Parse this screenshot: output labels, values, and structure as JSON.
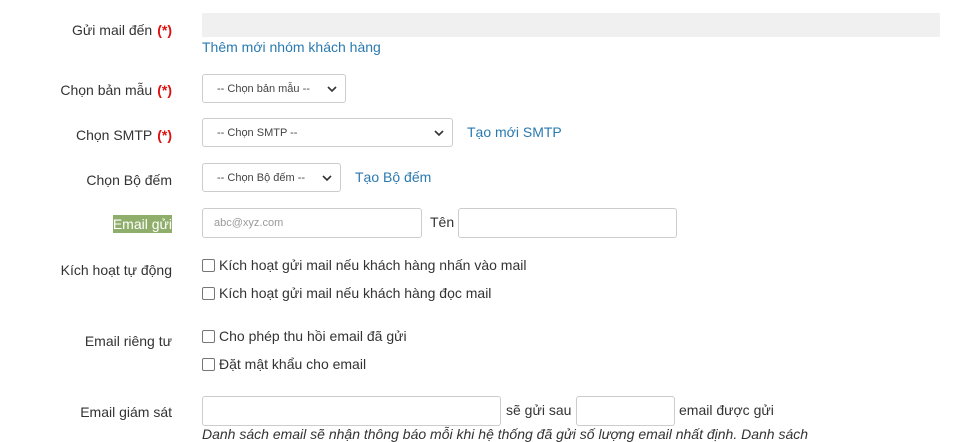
{
  "form": {
    "recipients": {
      "label": "Gửi mail đến",
      "required": "(*)",
      "value": "",
      "add_group_link": "Thêm mới nhóm khách hàng"
    },
    "template": {
      "label": "Chọn bản mẫu",
      "required": "(*)",
      "selected": "-- Chọn bản mẫu --"
    },
    "smtp": {
      "label": "Chọn SMTP",
      "required": "(*)",
      "selected": "-- Chọn SMTP --",
      "create_link": "Tạo mới SMTP"
    },
    "counter": {
      "label": "Chọn Bộ đếm",
      "selected": "-- Chọn Bộ đếm --",
      "create_link": "Tạo Bộ đếm"
    },
    "sender": {
      "label": "Email gửi",
      "email_placeholder": "abc@xyz.com",
      "email_value": "",
      "name_label": "Tên",
      "name_value": ""
    },
    "auto_activate": {
      "label": "Kích hoạt tự động",
      "options": [
        {
          "label": "Kích hoạt gửi mail nếu khách hàng nhấn vào mail",
          "checked": false
        },
        {
          "label": "Kích hoạt gửi mail nếu khách hàng đọc mail",
          "checked": false
        }
      ]
    },
    "privacy": {
      "label": "Email riêng tư",
      "options": [
        {
          "label": "Cho phép thu hồi email đã gửi",
          "checked": false
        },
        {
          "label": "Đặt mật khẩu cho email",
          "checked": false
        }
      ]
    },
    "monitor": {
      "label": "Email giám sát",
      "email_value": "",
      "send_after_label": "sẽ gửi sau",
      "count_value": "",
      "sent_suffix": "email được gửi",
      "note": "Danh sách email sẽ nhận thông báo mỗi khi hệ thống đã gửi số lượng email nhất định. Danh sách"
    }
  },
  "colors": {
    "required": "#dd1111",
    "link": "#2a7ab0",
    "highlight": "#8fae6b",
    "field_border": "#cccccc",
    "recipients_bg": "#f0f0f0"
  },
  "icons": {
    "select_arrow": "chevron-down-icon"
  }
}
